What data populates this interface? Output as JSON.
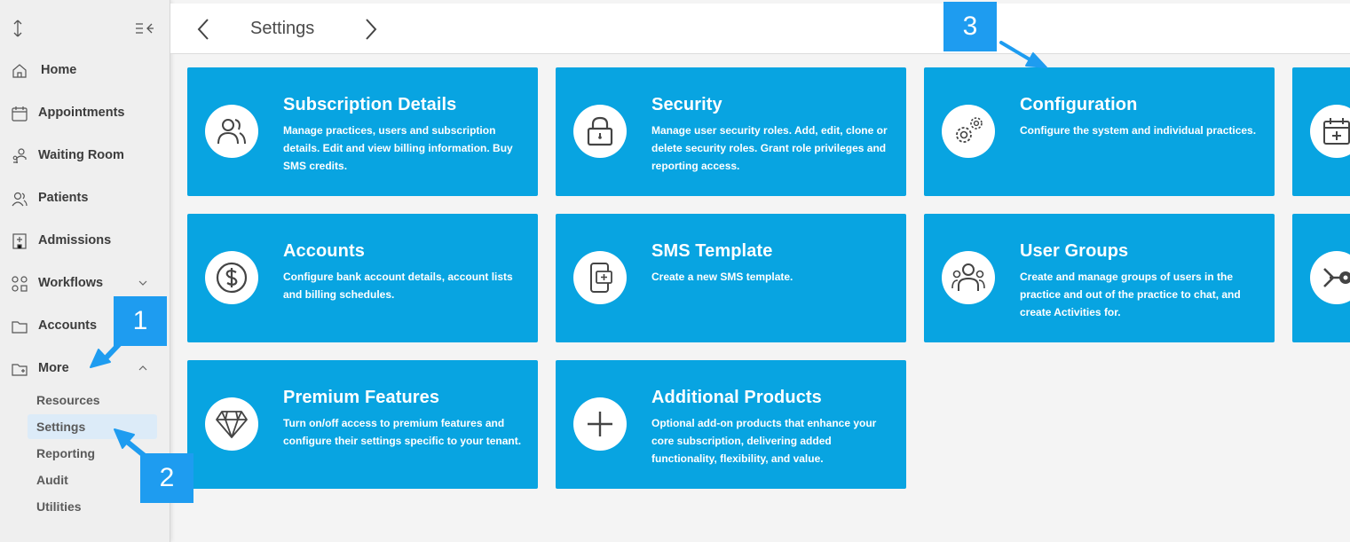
{
  "header": {
    "title": "Settings"
  },
  "sidebar": {
    "items": [
      {
        "label": "Home",
        "icon": "home-icon"
      },
      {
        "label": "Appointments",
        "icon": "calendar-icon"
      },
      {
        "label": "Waiting Room",
        "icon": "waiting-room-icon"
      },
      {
        "label": "Patients",
        "icon": "patients-icon"
      },
      {
        "label": "Admissions",
        "icon": "admissions-icon"
      },
      {
        "label": "Workflows",
        "icon": "workflows-icon"
      },
      {
        "label": "Accounts",
        "icon": "folder-icon"
      },
      {
        "label": "More",
        "icon": "folder-plus-icon"
      }
    ],
    "subitems": [
      {
        "label": "Resources"
      },
      {
        "label": "Settings"
      },
      {
        "label": "Reporting"
      },
      {
        "label": "Audit"
      },
      {
        "label": "Utilities"
      }
    ]
  },
  "cards": [
    {
      "title": "Subscription Details",
      "desc": "Manage practices, users and subscription details. Edit and view billing information. Buy SMS credits.",
      "icon": "users-icon"
    },
    {
      "title": "Security",
      "desc": "Manage user security roles. Add, edit, clone or delete security roles. Grant role privileges and reporting access.",
      "icon": "lock-icon"
    },
    {
      "title": "Configuration",
      "desc": "Configure the system and individual practices.",
      "icon": "gears-icon"
    },
    {
      "title": "Accounts",
      "desc": "Configure bank account details, account lists and billing schedules.",
      "icon": "dollar-icon"
    },
    {
      "title": "SMS Template",
      "desc": "Create a new SMS template.",
      "icon": "phone-message-icon"
    },
    {
      "title": "User Groups",
      "desc": "Create and manage groups of users in the practice and out of the practice to chat, and create Activities for.",
      "icon": "user-group-icon"
    },
    {
      "title": "Premium Features",
      "desc": "Turn on/off access to premium features and configure their settings specific to your tenant.",
      "icon": "diamond-icon"
    },
    {
      "title": "Additional Products",
      "desc": "Optional add-on products that enhance your core subscription, delivering added functionality, flexibility, and value.",
      "icon": "plus-icon"
    }
  ],
  "annotations": {
    "badge1": "1",
    "badge2": "2",
    "badge3": "3"
  },
  "colors": {
    "card": "#08a4e1",
    "badge": "#1e9cf0",
    "active_sub": "#dcebf8"
  }
}
